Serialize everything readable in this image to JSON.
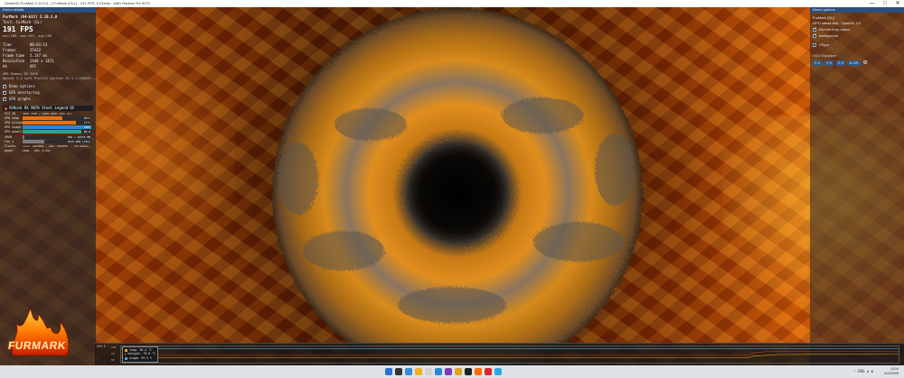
{
  "window": {
    "title": "Geeks3D FurMark 2.10.2.0 - [ FurMark (GL) ] - 191 FPS, 5.234ms - AMD Radeon RX 9070",
    "controls": [
      "—",
      "□",
      "✕"
    ]
  },
  "left_panel": {
    "header": "Demo details",
    "lines": {
      "app": "FurMark (64-bit) 2.10.2.0",
      "test": "Test: FurMark (GL)",
      "fps": "191 FPS",
      "fps_stats": "min:185, max:197, avg:190",
      "time_label": "Time",
      "time_value": "00:03:13",
      "frames_label": "Frames",
      "frames_value": "35432",
      "frametime_label": "Frame time",
      "frametime_value": "5.147 ms",
      "resolution_label": "Resolution",
      "resolution_value": "2448 x 1421",
      "aa_label": "AA",
      "aa_value": "OFF",
      "gpu_name": "AMD Radeon RX 9070",
      "gl_info": "OpenGL 3.2 Core Profile Context 25.3.1.250225..."
    },
    "checks": [
      {
        "label": "Demo options",
        "checked": true
      },
      {
        "label": "GPU monitoring",
        "checked": true
      },
      {
        "label": "GPU graphs",
        "checked": true
      }
    ],
    "gpu_monitor": {
      "title": "ASRock RX 9070 Steel Legend OC",
      "rows": [
        {
          "label": "PCI ID",
          "text": "1002-7550 / 1849-5489 (REV C3)"
        },
        {
          "label": "GPU temp",
          "value": "58°C",
          "fill": 0.58,
          "color": "#e8700a"
        },
        {
          "label": "GPU hotspot",
          "value": "77°C",
          "fill": 0.77,
          "color": "#e8700a"
        },
        {
          "label": "GPU usage",
          "value": "100%",
          "fill": 1.0,
          "color": "#2f86d6"
        },
        {
          "label": "GPU power",
          "value": "86 W",
          "fill": 0.86,
          "color": "#2aa58c"
        },
        {
          "label": "VRAM",
          "value": "296 / 16376 MB",
          "fill": 0.03,
          "color": "#7a7a7a"
        },
        {
          "label": "Fan %",
          "value": "1615 RPM (31%)",
          "fill": 0.31,
          "color": "#7a7a7a"
        },
        {
          "label": "Clocks",
          "text": "core: 2401MHz - mem: 2504MHz - (35.6Gbps)"
        },
        {
          "label": "power",
          "text": "288W - PPW: 0.662"
        }
      ]
    }
  },
  "right_panel": {
    "header": "Demo options",
    "lines": [
      "FurMark (GL)",
      "GPU stress test - OpenGL 3.2"
    ],
    "checks": [
      {
        "label": "Render furry object",
        "checked": true
      },
      {
        "label": "background",
        "checked": true
      },
      {
        "label": "VSync",
        "checked": false
      }
    ],
    "ssao_label": "SSO Equalizer",
    "ssao_fields": [
      "X: 0",
      "Y: 0",
      "Z: 0",
      "A: 120"
    ]
  },
  "graph": {
    "title": "GPU 0",
    "axis_labels": [
      "100",
      "80",
      "60"
    ],
    "legend": [
      {
        "label": "temp: 58.4 °C",
        "color": "#e8a020"
      },
      {
        "label": "hotspot: 78.0 °C",
        "color": "#d04010"
      },
      {
        "label": "usage: 99.9 %",
        "color": "#40a0e0"
      }
    ]
  },
  "logo": {
    "text": "FURMARK",
    "subtitle": "2.10.2.0 build Oct 29 2025@07:47:02"
  },
  "taskbar": {
    "time": "13:24",
    "date": "4/12/2025",
    "tray": "⌃  ENG  ◖  ▮",
    "icons": [
      "#2a6fd6",
      "#333",
      "#3a8ad8",
      "#f2b21b",
      "#d0d0d0",
      "#2f86d6",
      "#7a3db8",
      "#e0a020",
      "#222",
      "#ff6a00",
      "#d62a2a",
      "#2aa8e0"
    ]
  }
}
